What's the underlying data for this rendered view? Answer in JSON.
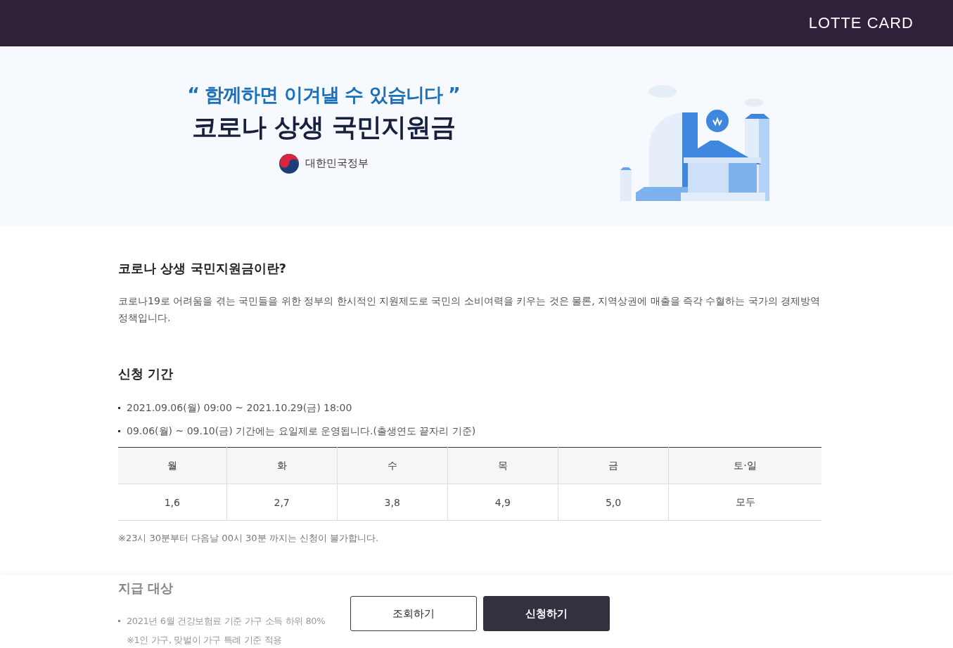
{
  "header": {
    "logo": "LOTTE CARD"
  },
  "banner": {
    "slogan": "“ 함께하면 이겨낼 수 있습니다 ”",
    "title": "코로나 상생 국민지원금",
    "issuer": "대한민국정부"
  },
  "intro": {
    "heading": "코로나 상생 국민지원금이란?",
    "paragraph": "코로나19로 어려움을 겪는 국민들을 위한 정부의 한시적인 지원제도로 국민의 소비여력을 키우는 것은 물론, 지역상권에 매출을 즉각 수혈하는 국가의 경제방역 정책입니다."
  },
  "period": {
    "heading": "신청 기간",
    "bullets": [
      "2021.09.06(월) 09:00 ~ 2021.10.29(금) 18:00",
      "09.06(월) ~ 09.10(금) 기간에는 요일제로 운영됩니다.(출생연도 끝자리 기준)"
    ],
    "table": {
      "columns": [
        "월",
        "화",
        "수",
        "목",
        "금",
        "토·일"
      ],
      "rows": [
        [
          "1,6",
          "2,7",
          "3,8",
          "4,9",
          "5,0",
          "모두"
        ]
      ]
    },
    "note": "※23시 30분부터 다음날 00시 30분 까지는 신청이 불가합니다."
  },
  "eligibility": {
    "heading": "지급 대상",
    "bullets": [
      {
        "text": "2021년 6월 건강보험료 기준 가구 소득 하위 80%",
        "note": "※1인 가구, 맞벌이 가구 특례 기준 적용"
      }
    ]
  },
  "actions": [
    {
      "label": "조회하기",
      "kind": "secondary"
    },
    {
      "label": "신청하기",
      "kind": "primary"
    }
  ]
}
